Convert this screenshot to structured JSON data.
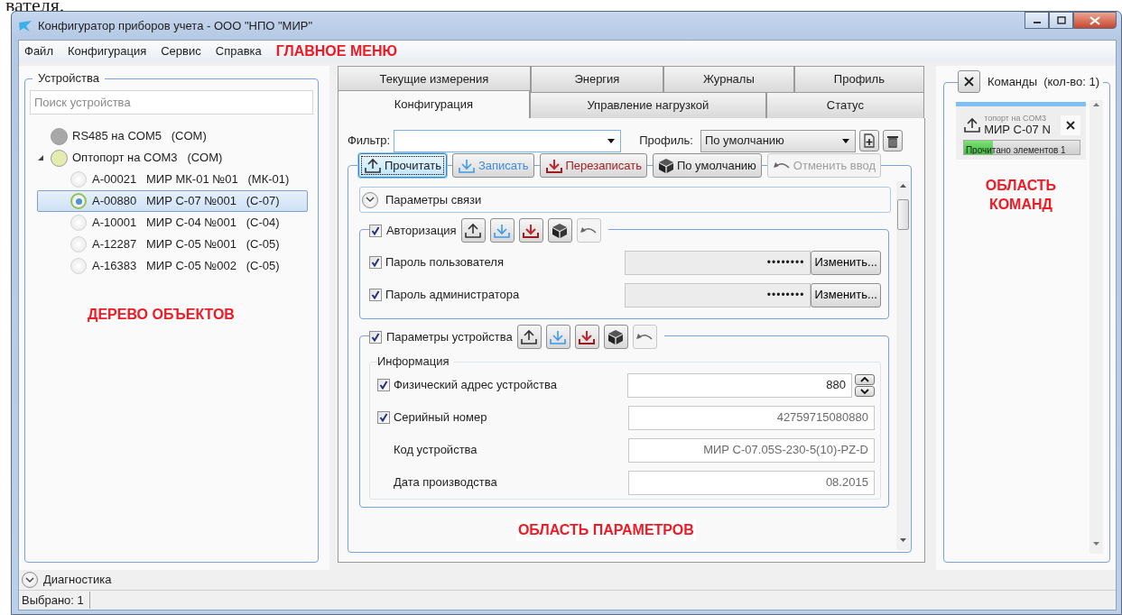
{
  "doc_text": "вателя.",
  "window": {
    "title": "Конфигуратор приборов учета - ООО \"НПО \"МИР\""
  },
  "menu": {
    "items": [
      "Файл",
      "Конфигурация",
      "Сервис",
      "Справка"
    ],
    "annotation": "ГЛАВНОЕ МЕНЮ"
  },
  "devices": {
    "title": "Устройства",
    "search": {
      "placeholder": "Поиск устройства"
    },
    "ports": [
      {
        "label": "RS485 на COM5   (COM)",
        "color": "#a8a8a8"
      },
      {
        "label": "Оптопорт на COM3   (COM)",
        "color": "#e4ecb0",
        "children": [
          {
            "label": "A-00021   МИР МК-01 №01   (МК-01)",
            "selected": false
          },
          {
            "label": "A-00880   МИР С-07 №001   (С-07)",
            "selected": true
          },
          {
            "label": "A-10001   МИР С-04 №001   (С-04)",
            "selected": false
          },
          {
            "label": "A-12287   МИР С-05 №001   (С-05)",
            "selected": false
          },
          {
            "label": "A-16383   МИР С-05 №002   (С-05)",
            "selected": false
          }
        ]
      }
    ],
    "annotation": "ДЕРЕВО ОБЪЕКТОВ"
  },
  "tabs": [
    [
      {
        "label": "Текущие измерения",
        "selected": false
      },
      {
        "label": "Энергия",
        "selected": false
      },
      {
        "label": "Журналы",
        "selected": false
      },
      {
        "label": "Профиль",
        "selected": false
      }
    ],
    [
      {
        "label": "Конфигурация",
        "selected": true
      },
      {
        "label": "Управление нагрузкой",
        "selected": false
      },
      {
        "label": "Статус",
        "selected": false
      }
    ]
  ],
  "filter": {
    "label": "Фильтр:"
  },
  "profile": {
    "label": "Профиль:",
    "value": "По умолчанию"
  },
  "toolbar": [
    {
      "label": "Прочитать",
      "kind": "read",
      "disabled": false,
      "focused": true
    },
    {
      "label": "Записать",
      "kind": "write",
      "disabled": false,
      "focused": false
    },
    {
      "label": "Перезаписать",
      "kind": "rewrite",
      "disabled": false,
      "focused": false
    },
    {
      "label": "По умолчанию",
      "kind": "default",
      "disabled": false,
      "focused": false
    },
    {
      "label": "Отменить ввод",
      "kind": "undo",
      "disabled": true,
      "focused": false
    }
  ],
  "sections": [
    {
      "kind": "expander",
      "label": "Параметры связи",
      "expanded": false
    },
    {
      "kind": "group",
      "label": "Авторизация",
      "checked": true,
      "rows": [
        {
          "label": "Пароль пользователя",
          "checked": true,
          "kind": "password",
          "value": "••••••••",
          "button": "Изменить..."
        },
        {
          "label": "Пароль администратора",
          "checked": true,
          "kind": "password",
          "value": "••••••••",
          "button": "Изменить..."
        }
      ]
    },
    {
      "kind": "group",
      "label": "Параметры устройства",
      "checked": true,
      "subgroups": [
        {
          "title": "Информация",
          "rows": [
            {
              "label": "Физический адрес устройства",
              "checked": true,
              "kind": "spin",
              "value": "880"
            },
            {
              "label": "Серийный номер",
              "checked": true,
              "kind": "readonly",
              "value": "42759715080880"
            },
            {
              "label": "Код устройства",
              "kind": "readonly",
              "value": "МИР С-07.05S-230-5(10)-PZ-D"
            },
            {
              "label": "Дата производства",
              "kind": "readonly",
              "value": "08.2015"
            }
          ]
        }
      ]
    }
  ],
  "params_annotation": "ОБЛАСТЬ ПАРАМЕТРОВ",
  "commands": {
    "title": "Команды  (кол-во: 1)",
    "items": [
      {
        "source": "топорт на COM3",
        "device": "МИР С-07 N",
        "progress_text": "Прочитано элементов 1",
        "level": 0.25
      }
    ],
    "annotation": "ОБЛАСТЬ КОМАНД"
  },
  "diagnostics": {
    "label": "Диагностика",
    "expanded": false
  },
  "status_bar": {
    "text": "Выбрано: 1"
  }
}
